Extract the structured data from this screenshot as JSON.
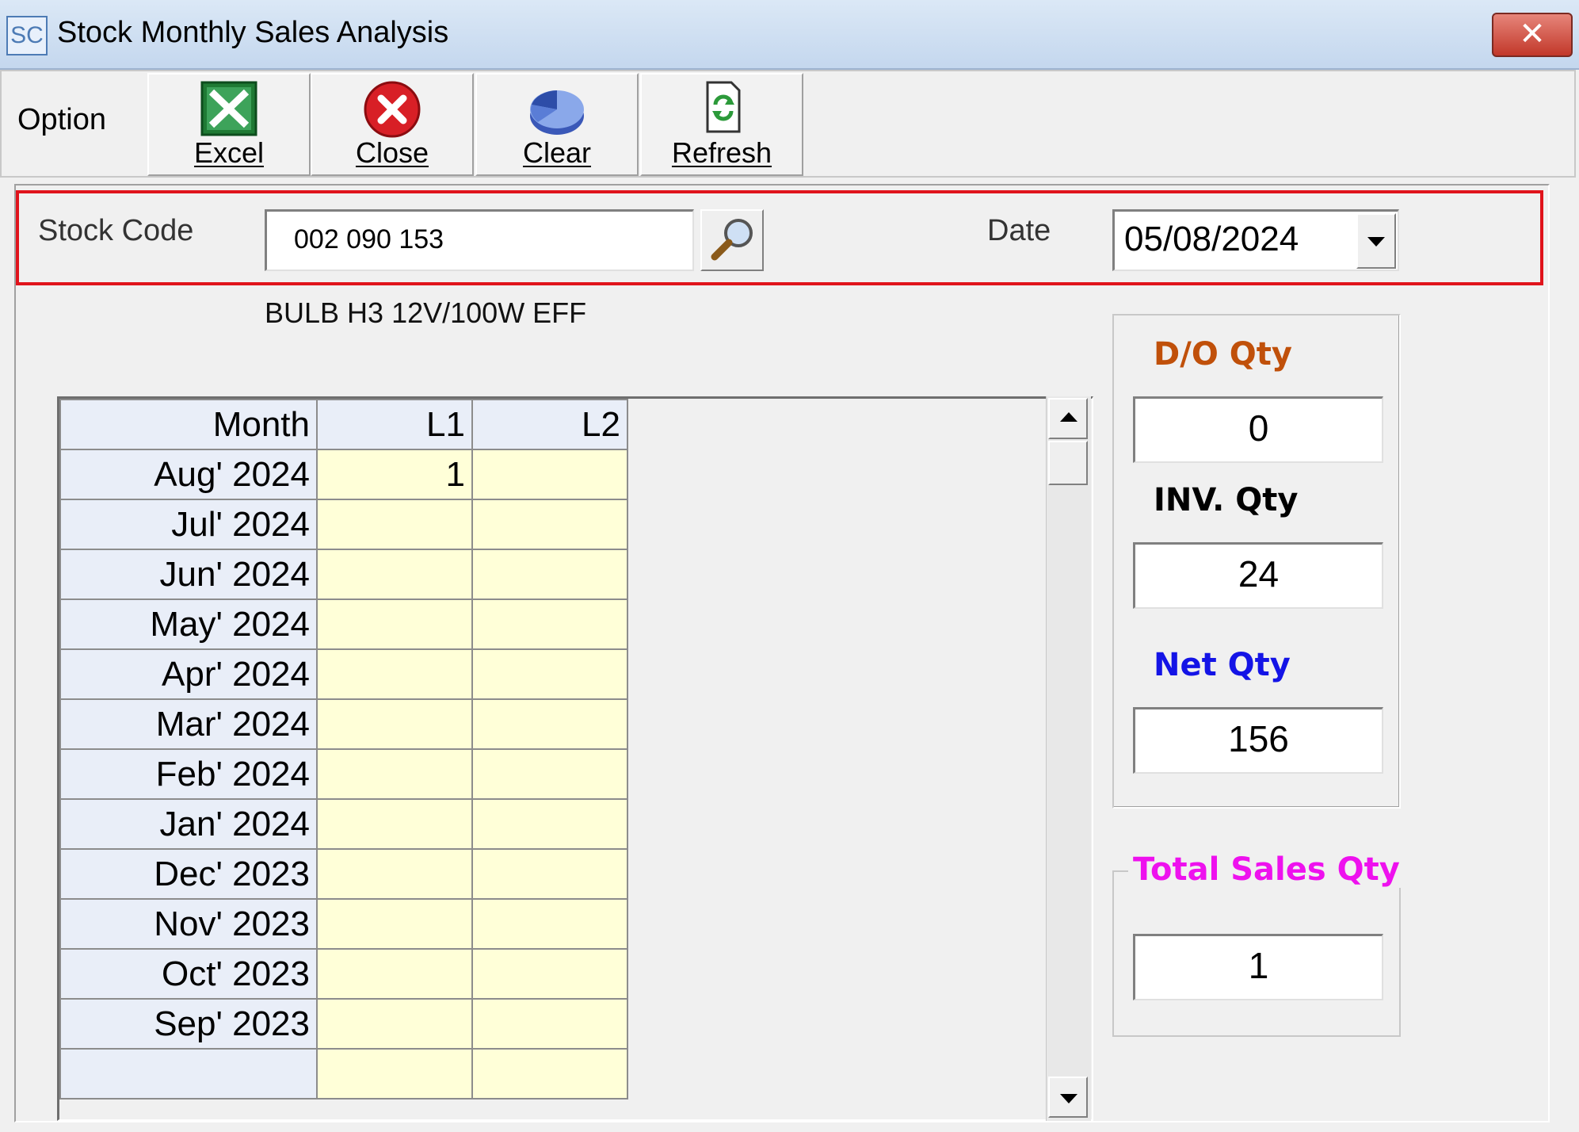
{
  "window": {
    "icon_text": "SC",
    "title": "Stock Monthly Sales Analysis",
    "close_glyph": "✕"
  },
  "toolbar": {
    "option_label": "Option",
    "buttons": [
      {
        "label": "Excel",
        "icon": "excel-icon"
      },
      {
        "label": "Close",
        "icon": "close-circle-icon"
      },
      {
        "label": "Clear",
        "icon": "pie-chart-icon"
      },
      {
        "label": "Refresh",
        "icon": "refresh-document-icon"
      }
    ]
  },
  "filter": {
    "stock_code_label": "Stock Code",
    "stock_code_value": "002 090 153",
    "date_label": "Date",
    "date_value": "05/08/2024",
    "description": "BULB H3 12V/100W EFF"
  },
  "grid": {
    "columns": [
      "Month",
      "L1",
      "L2"
    ],
    "rows": [
      {
        "month": "Aug' 2024",
        "l1": "1",
        "l2": ""
      },
      {
        "month": "Jul' 2024",
        "l1": "",
        "l2": ""
      },
      {
        "month": "Jun' 2024",
        "l1": "",
        "l2": ""
      },
      {
        "month": "May' 2024",
        "l1": "",
        "l2": ""
      },
      {
        "month": "Apr' 2024",
        "l1": "",
        "l2": ""
      },
      {
        "month": "Mar' 2024",
        "l1": "",
        "l2": ""
      },
      {
        "month": "Feb' 2024",
        "l1": "",
        "l2": ""
      },
      {
        "month": "Jan' 2024",
        "l1": "",
        "l2": ""
      },
      {
        "month": "Dec' 2023",
        "l1": "",
        "l2": ""
      },
      {
        "month": "Nov' 2023",
        "l1": "",
        "l2": ""
      },
      {
        "month": "Oct' 2023",
        "l1": "",
        "l2": ""
      },
      {
        "month": "Sep' 2023",
        "l1": "",
        "l2": ""
      },
      {
        "month": "",
        "l1": "",
        "l2": ""
      }
    ]
  },
  "summary": {
    "do_qty_label": "D/O Qty",
    "do_qty_value": "0",
    "inv_qty_label": "INV. Qty",
    "inv_qty_value": "24",
    "net_qty_label": "Net Qty",
    "net_qty_value": "156",
    "total_sales_label": "Total Sales Qty",
    "total_sales_value": "1"
  },
  "colors": {
    "do_qty": "#c0500a",
    "inv_qty": "#000000",
    "net_qty": "#1414e6",
    "total_sales": "#ee11ee",
    "highlight_border": "#e0141c",
    "grid_value_bg": "#ffffd8",
    "grid_month_bg": "#e9eef8"
  }
}
